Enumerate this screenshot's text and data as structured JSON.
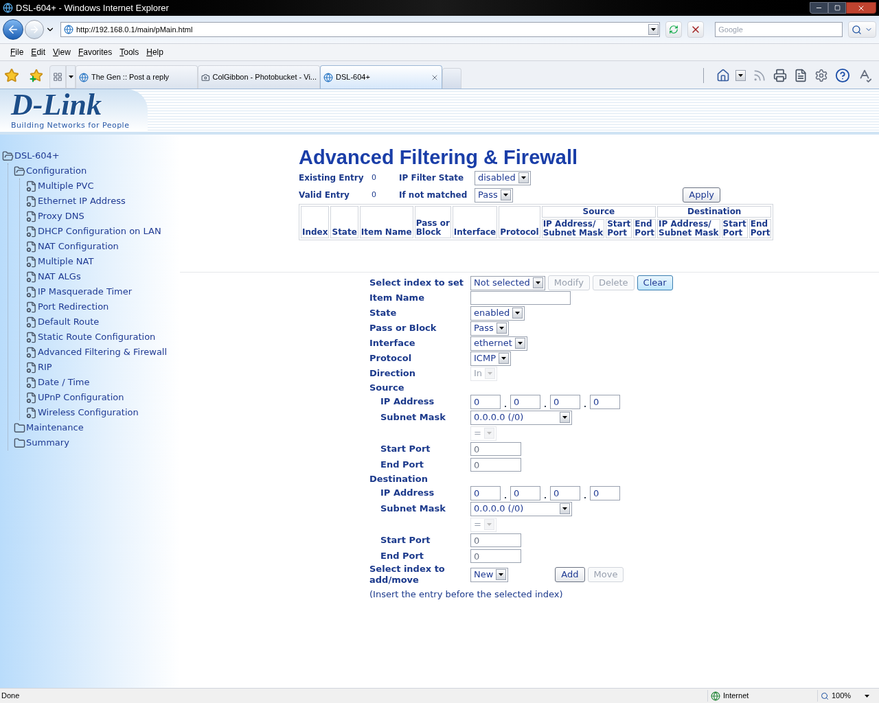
{
  "window": {
    "title": "DSL-604+ - Windows Internet Explorer"
  },
  "browser": {
    "address": "http://192.168.0.1/main/pMain.html",
    "search_placeholder": "Google",
    "menu": [
      "File",
      "Edit",
      "View",
      "Favorites",
      "Tools",
      "Help"
    ],
    "tabs": [
      {
        "label": "The Gen :: Post a reply",
        "kind": "web",
        "selected": false
      },
      {
        "label": "ColGibbon - Photobucket - Vi...",
        "kind": "photo",
        "selected": false
      },
      {
        "label": "DSL-604+",
        "kind": "web",
        "selected": true
      }
    ]
  },
  "page": {
    "logo": {
      "text": "D-Link",
      "tagline": "Building Networks for People"
    },
    "tree": {
      "label": "DSL-604+",
      "kind": "folder",
      "expanded": true,
      "children": [
        {
          "label": "Configuration",
          "kind": "folder",
          "expanded": true,
          "children": [
            {
              "label": "Multiple PVC",
              "kind": "page"
            },
            {
              "label": "Ethernet IP Address",
              "kind": "page"
            },
            {
              "label": "Proxy DNS",
              "kind": "page"
            },
            {
              "label": "DHCP Configuration on LAN",
              "kind": "page"
            },
            {
              "label": "NAT Configuration",
              "kind": "page"
            },
            {
              "label": "Multiple NAT",
              "kind": "page"
            },
            {
              "label": "NAT ALGs",
              "kind": "page"
            },
            {
              "label": "IP Masquerade Timer",
              "kind": "page"
            },
            {
              "label": "Port Redirection",
              "kind": "page"
            },
            {
              "label": "Default Route",
              "kind": "page"
            },
            {
              "label": "Static Route Configuration",
              "kind": "page"
            },
            {
              "label": "Advanced Filtering & Firewall",
              "kind": "page"
            },
            {
              "label": "RIP",
              "kind": "page"
            },
            {
              "label": "Date / Time",
              "kind": "page"
            },
            {
              "label": "UPnP Configuration",
              "kind": "page"
            },
            {
              "label": "Wireless Configuration",
              "kind": "page"
            }
          ]
        },
        {
          "label": "Maintenance",
          "kind": "folder",
          "expanded": false
        },
        {
          "label": "Summary",
          "kind": "folder",
          "expanded": false
        }
      ]
    },
    "heading": "Advanced Filtering & Firewall",
    "summary": [
      {
        "label": "Existing Entry",
        "value": "0",
        "field_label": "IP Filter State",
        "field_value": "disabled"
      },
      {
        "label": "Valid Entry",
        "value": "0",
        "field_label": "If not matched",
        "field_value": "Pass"
      }
    ],
    "apply_button": "Apply",
    "table": {
      "columns": [
        "Index",
        "State",
        "Item Name",
        "Pass or\nBlock",
        "Interface",
        "Protocol"
      ],
      "groups": [
        {
          "label": "Source",
          "columns": [
            "IP Address/\nSubnet Mask",
            "Start\nPort",
            "End\nPort"
          ]
        },
        {
          "label": "Destination",
          "columns": [
            "IP Address/\nSubnet Mask",
            "Start\nPort",
            "End\nPort"
          ]
        }
      ]
    },
    "form": [
      {
        "kind": "select",
        "label": "Select index to set",
        "value": "Not selected",
        "disabled": false,
        "buttons": [
          {
            "label": "Modify",
            "disabled": true
          },
          {
            "label": "Delete",
            "disabled": true
          },
          {
            "label": "Clear",
            "disabled": false
          }
        ]
      },
      {
        "kind": "text",
        "label": "Item Name"
      },
      {
        "kind": "select",
        "label": "State",
        "value": "enabled",
        "disabled": false
      },
      {
        "kind": "select",
        "label": "Pass or Block",
        "value": "Pass",
        "disabled": false
      },
      {
        "kind": "select",
        "label": "Interface",
        "value": "ethernet",
        "disabled": false
      },
      {
        "kind": "select",
        "label": "Protocol",
        "value": "ICMP",
        "disabled": false
      },
      {
        "kind": "select",
        "label": "Direction",
        "value": "In",
        "disabled": true
      },
      {
        "kind": "section",
        "label": "Source",
        "children": [
          {
            "kind": "ip",
            "label": "IP Address",
            "octets": [
              "0",
              "0",
              "0",
              "0"
            ]
          },
          {
            "kind": "mask",
            "label": "Subnet Mask",
            "value": "0.0.0.0 (/0)",
            "disabled": false
          },
          {
            "kind": "select",
            "value": "=",
            "disabled": true
          },
          {
            "kind": "text",
            "label": "Start Port",
            "value": "0",
            "disabled": true
          },
          {
            "kind": "text",
            "label": "End Port",
            "value": "0",
            "disabled": true
          }
        ]
      },
      {
        "kind": "section",
        "label": "Destination",
        "children": [
          {
            "kind": "ip",
            "label": "IP Address",
            "octets": [
              "0",
              "0",
              "0",
              "0"
            ]
          },
          {
            "kind": "mask",
            "label": "Subnet Mask",
            "value": "0.0.0.0 (/0)",
            "disabled": false
          },
          {
            "kind": "select",
            "value": "=",
            "disabled": true
          },
          {
            "kind": "text",
            "label": "Start Port",
            "value": "0",
            "disabled": true
          },
          {
            "kind": "text",
            "label": "End Port",
            "value": "0",
            "disabled": true
          }
        ]
      },
      {
        "kind": "select",
        "label": "Select index to add/move",
        "value": "New",
        "disabled": false,
        "buttons": [
          {
            "label": "Add",
            "disabled": false
          },
          {
            "label": "Move",
            "disabled": true
          }
        ],
        "note": "(Insert the entry before the selected index)"
      }
    ]
  },
  "status_bar": {
    "text": "Done",
    "zone": "Internet",
    "zoom": "100%"
  }
}
